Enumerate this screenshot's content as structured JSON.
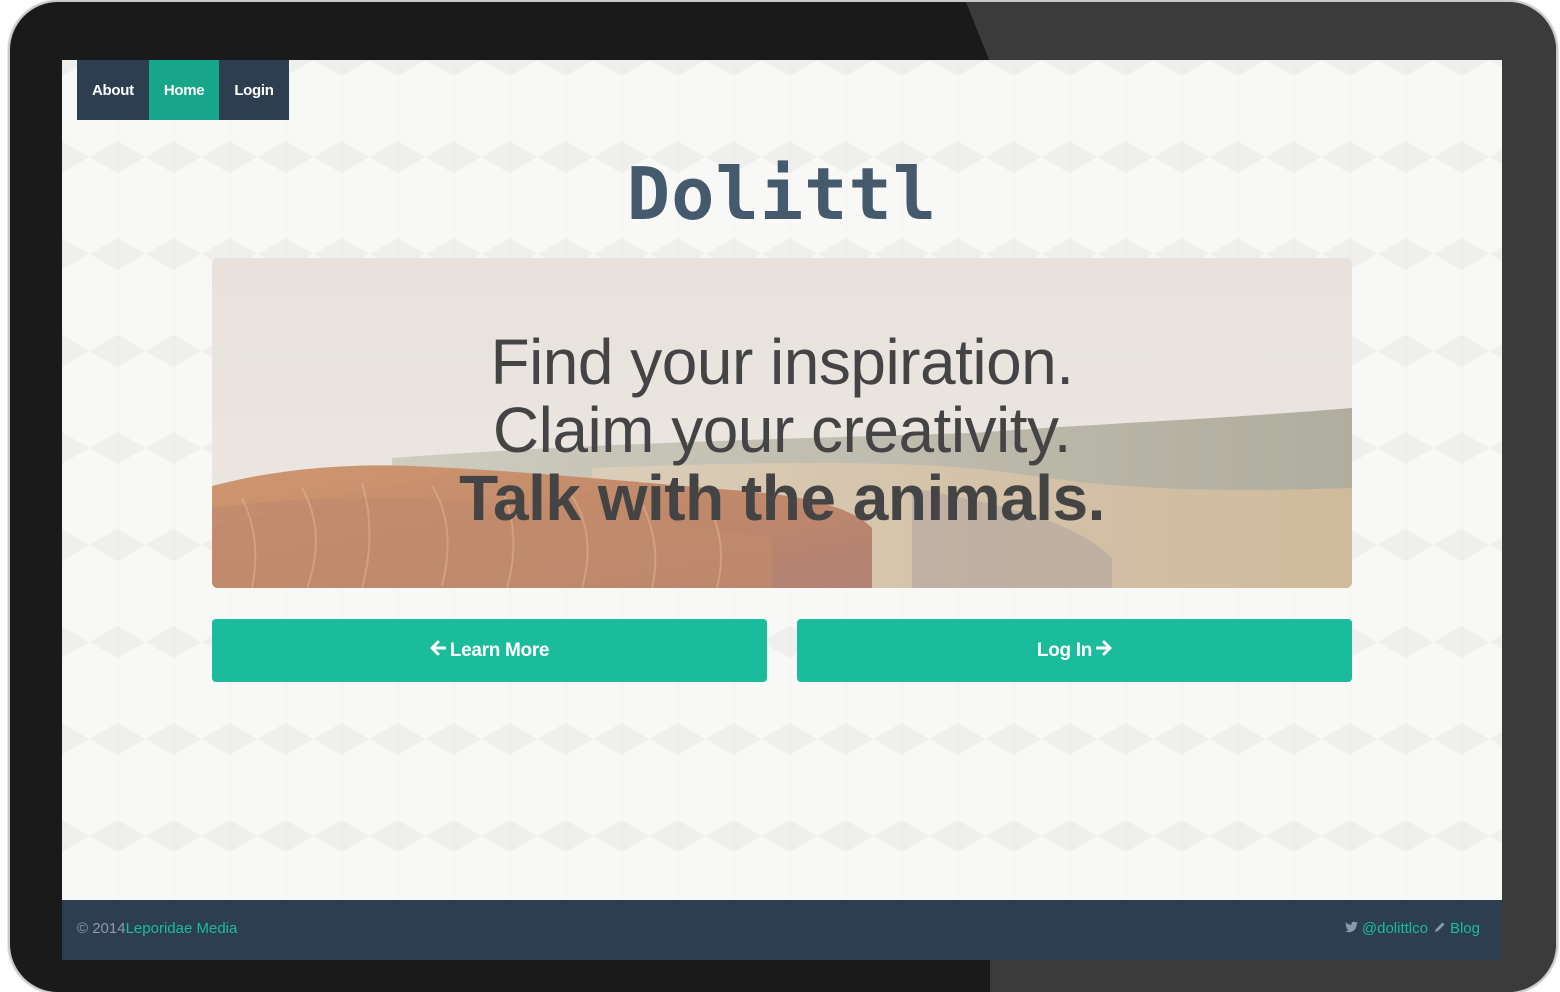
{
  "nav": {
    "items": [
      {
        "label": "About"
      },
      {
        "label": "Home"
      },
      {
        "label": "Login"
      }
    ]
  },
  "logo": {
    "text": "Dolittl"
  },
  "hero": {
    "line1": "Find your inspiration.",
    "line2": "Claim your creativity.",
    "line3": "Talk with the animals."
  },
  "buttons": {
    "learn_more": "Learn More",
    "log_in": "Log In"
  },
  "footer": {
    "copyright": "© 2014",
    "company": "Leporidae Media",
    "twitter": "@dolittlco",
    "blog": "Blog"
  },
  "colors": {
    "navy": "#2c3e50",
    "teal": "#1abc9c",
    "teal_active": "#18a68a",
    "logo": "#465a6e"
  },
  "icons": [
    "arrow-left-icon",
    "arrow-right-icon",
    "twitter-icon",
    "pencil-icon"
  ]
}
